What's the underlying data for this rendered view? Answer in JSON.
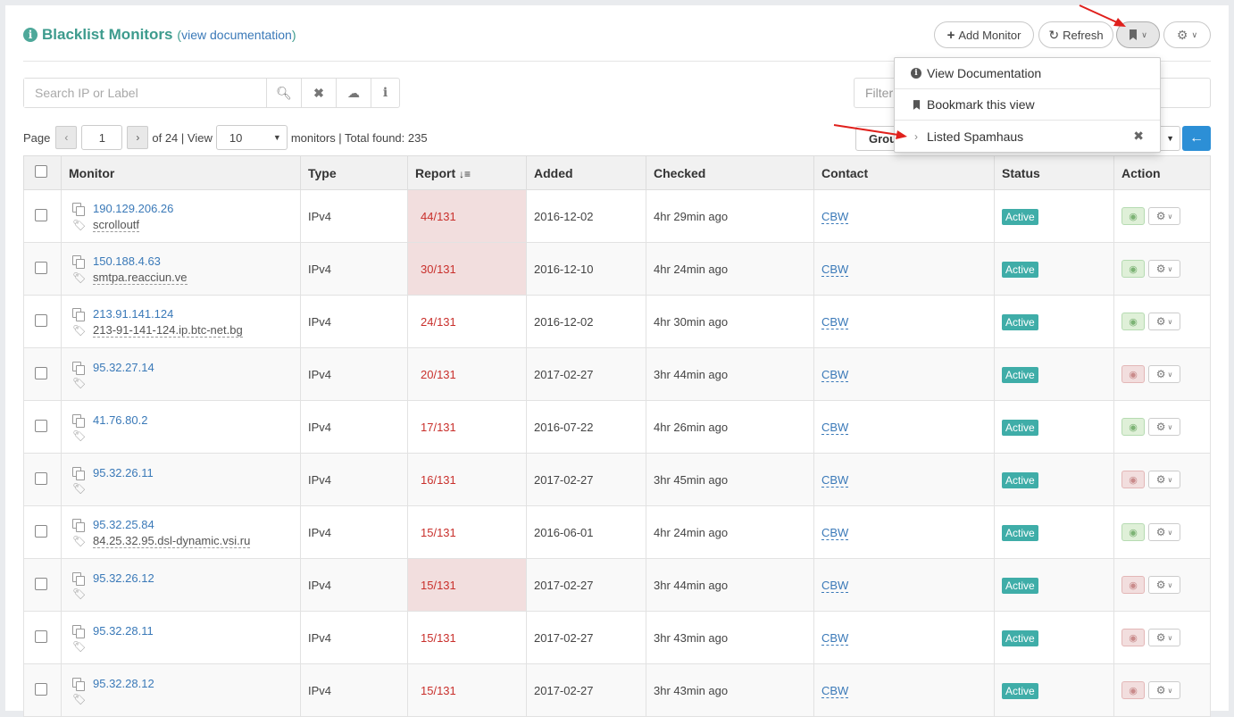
{
  "header": {
    "title": "Blacklist Monitors",
    "paren_open": "(",
    "doc_link": "view documentation",
    "paren_close": ")"
  },
  "toolbar": {
    "add_monitor": "Add Monitor",
    "refresh": "Refresh"
  },
  "search": {
    "placeholder": "Search IP or Label"
  },
  "filter": {
    "placeholder": "Filter"
  },
  "pager": {
    "page_label": "Page",
    "page_value": "1",
    "of_text": "of 24 | View",
    "per_page": "10",
    "summary": "monitors | Total found: 235"
  },
  "group_select": {
    "value": "Group"
  },
  "dropdown": {
    "items": [
      {
        "label": "View Documentation",
        "icon": "info-circle-icon"
      },
      {
        "label": "Bookmark this view",
        "icon": "bookmark-icon"
      },
      {
        "label": "Listed Spamhaus",
        "icon": "chevron-right-icon"
      }
    ]
  },
  "table": {
    "columns": [
      "Monitor",
      "Type",
      "Report",
      "Added",
      "Checked",
      "Contact",
      "Status",
      "Action"
    ],
    "rows": [
      {
        "ip": "190.129.206.26",
        "label": "scrolloutf",
        "type": "IPv4",
        "report": "44/131",
        "added": "2016-12-02",
        "checked": "4hr 29min ago",
        "contact": "CBW",
        "status": "Active"
      },
      {
        "ip": "150.188.4.63",
        "label": "smtpa.reacciun.ve",
        "type": "IPv4",
        "report": "30/131",
        "added": "2016-12-10",
        "checked": "4hr 24min ago",
        "contact": "CBW",
        "status": "Active"
      },
      {
        "ip": "213.91.141.124",
        "label": "213-91-141-124.ip.btc-net.bg",
        "type": "IPv4",
        "report": "24/131",
        "added": "2016-12-02",
        "checked": "4hr 30min ago",
        "contact": "CBW",
        "status": "Active"
      },
      {
        "ip": "95.32.27.14",
        "label": "",
        "type": "IPv4",
        "report": "20/131",
        "added": "2017-02-27",
        "checked": "3hr 44min ago",
        "contact": "CBW",
        "status": "Active"
      },
      {
        "ip": "41.76.80.2",
        "label": "",
        "type": "IPv4",
        "report": "17/131",
        "added": "2016-07-22",
        "checked": "4hr 26min ago",
        "contact": "CBW",
        "status": "Active"
      },
      {
        "ip": "95.32.26.11",
        "label": "",
        "type": "IPv4",
        "report": "16/131",
        "added": "2017-02-27",
        "checked": "3hr 45min ago",
        "contact": "CBW",
        "status": "Active"
      },
      {
        "ip": "95.32.25.84",
        "label": "84.25.32.95.dsl-dynamic.vsi.ru",
        "type": "IPv4",
        "report": "15/131",
        "added": "2016-06-01",
        "checked": "4hr 24min ago",
        "contact": "CBW",
        "status": "Active"
      },
      {
        "ip": "95.32.26.12",
        "label": "",
        "type": "IPv4",
        "report": "15/131",
        "added": "2017-02-27",
        "checked": "3hr 44min ago",
        "contact": "CBW",
        "status": "Active"
      },
      {
        "ip": "95.32.28.11",
        "label": "",
        "type": "IPv4",
        "report": "15/131",
        "added": "2017-02-27",
        "checked": "3hr 43min ago",
        "contact": "CBW",
        "status": "Active"
      },
      {
        "ip": "95.32.28.12",
        "label": "",
        "type": "IPv4",
        "report": "15/131",
        "added": "2017-02-27",
        "checked": "3hr 43min ago",
        "contact": "CBW",
        "status": "Active"
      }
    ]
  },
  "colors": {
    "accent": "#3d9b8d",
    "link": "#3a79b8",
    "report_text": "#c9302c",
    "report_highlight": "#f2dede",
    "status_badge": "#3fada8",
    "back_button": "#2c8fd6",
    "annotation_arrow": "#e0201c"
  }
}
